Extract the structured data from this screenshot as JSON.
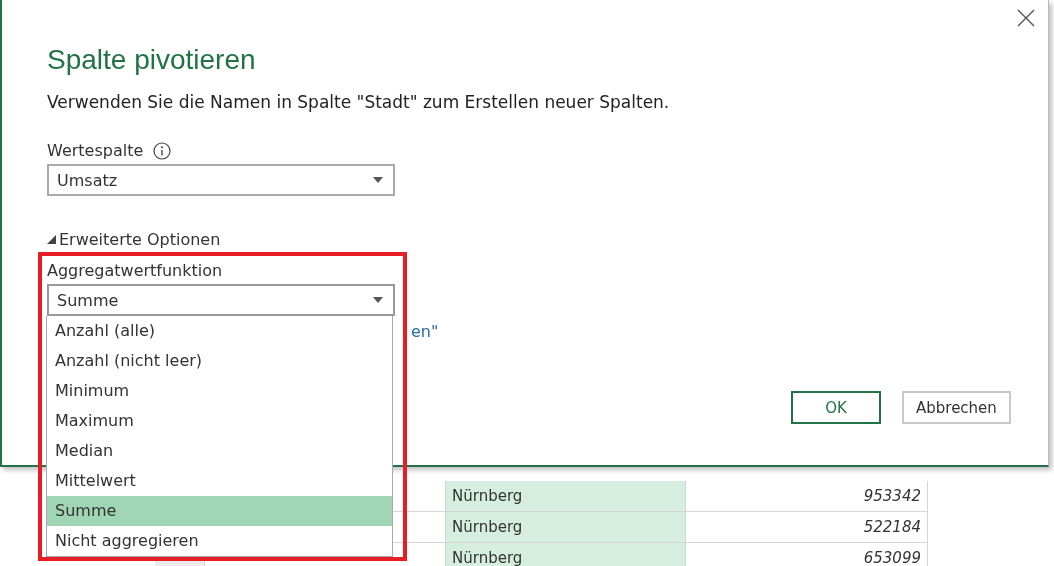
{
  "sheet": {
    "rows": [
      {
        "row_number": "",
        "month": "",
        "city": "Nürnberg",
        "value": "953342"
      },
      {
        "row_number": "",
        "month": "",
        "city": "Nürnberg",
        "value": "522184"
      },
      {
        "row_number": "",
        "month": "",
        "city": "Nürnberg",
        "value": "653099"
      }
    ]
  },
  "dialog": {
    "title": "Spalte pivotieren",
    "description": "Verwenden Sie die Namen in Spalte \"Stadt\" zum Erstellen neuer Spalten.",
    "value_column": {
      "label": "Wertespalte",
      "value": "Umsatz"
    },
    "advanced_options": {
      "label": "Erweiterte Optionen",
      "expanded": true
    },
    "aggregate_function": {
      "label": "Aggregatwertfunktion",
      "value": "Summe",
      "expanded": true,
      "options": [
        {
          "label": "Anzahl (alle)",
          "selected": false
        },
        {
          "label": "Anzahl (nicht leer)",
          "selected": false
        },
        {
          "label": "Minimum",
          "selected": false
        },
        {
          "label": "Maximum",
          "selected": false
        },
        {
          "label": "Median",
          "selected": false
        },
        {
          "label": "Mittelwert",
          "selected": false
        },
        {
          "label": "Summe",
          "selected": true
        },
        {
          "label": "Nicht aggregieren",
          "selected": false
        }
      ]
    },
    "link_fragment": "en\"",
    "buttons": [
      {
        "label": "OK",
        "kind": "primary"
      },
      {
        "label": "Abbrechen",
        "kind": "secondary"
      }
    ]
  }
}
